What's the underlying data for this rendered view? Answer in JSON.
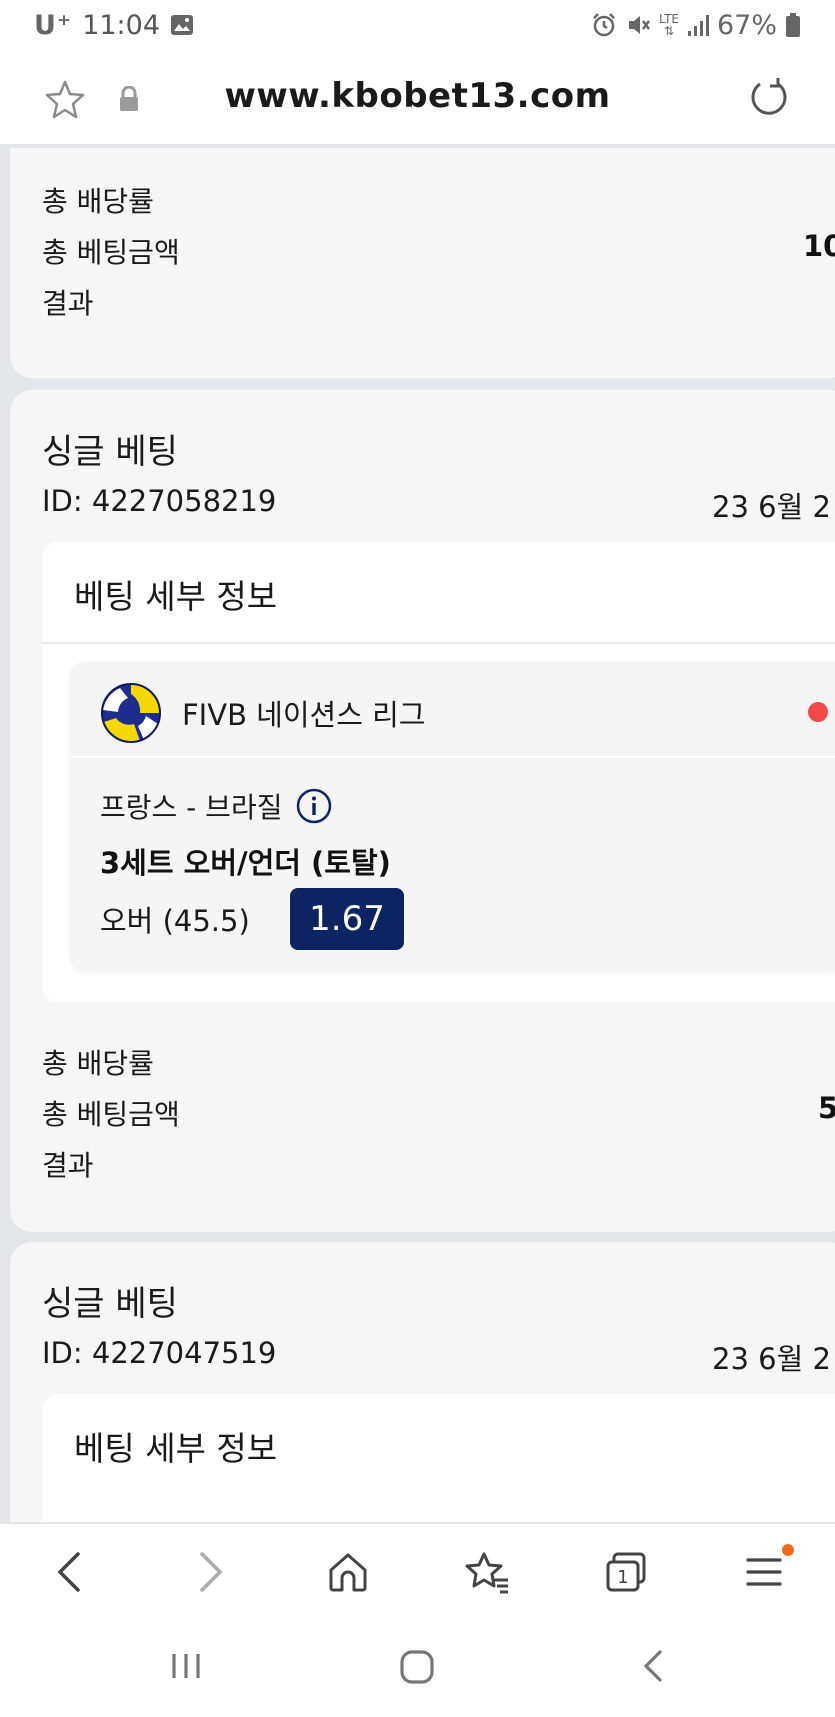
{
  "status_bar": {
    "carrier": "U⁺",
    "time": "11:04",
    "network": "LTE",
    "battery": "67%"
  },
  "browser": {
    "url": "www.kbobet13.com"
  },
  "cards": [
    {
      "summary": {
        "total_odds_label": "총 배당률",
        "total_stake_label": "총 베팅금액",
        "total_stake_value": "10",
        "result_label": "결과"
      }
    },
    {
      "title": "싱글 베팅",
      "id_text": "ID: 4227058219",
      "date_text": "23 6월 2",
      "detail_title": "베팅 세부 정보",
      "event": {
        "league": "FIVB 네이션스 리그",
        "match": "프랑스 - 브라질",
        "market": "3세트 오버/언더 (토탈)",
        "selection": "오버 (45.5)",
        "odds": "1.67"
      },
      "summary": {
        "total_odds_label": "총 배당률",
        "total_stake_label": "총 베팅금액",
        "total_stake_value": "5",
        "result_label": "결과"
      }
    },
    {
      "title": "싱글 베팅",
      "id_text": "ID: 4227047519",
      "date_text": "23 6월 2",
      "detail_title": "베팅 세부 정보"
    }
  ],
  "icons": {
    "status_left": [
      "gallery-icon"
    ],
    "status_right": [
      "alarm-icon",
      "mute-icon",
      "lte-signal-icon",
      "signal-bars-icon",
      "battery-icon"
    ],
    "url_bar": [
      "bookmark-star-icon",
      "lock-icon",
      "reload-icon"
    ],
    "toolbar": [
      "back-arrow-icon",
      "forward-arrow-icon",
      "home-icon",
      "bookmarks-icon",
      "tabs-icon",
      "menu-icon"
    ],
    "navbar": [
      "recent-apps-icon",
      "home-circle-icon",
      "nav-back-icon"
    ]
  },
  "toolbar": {
    "tabs_count": "1"
  },
  "colors": {
    "odds_badge": "#0c2461",
    "live_dot": "#f04a4a",
    "notification_dot": "#f26b1d"
  }
}
